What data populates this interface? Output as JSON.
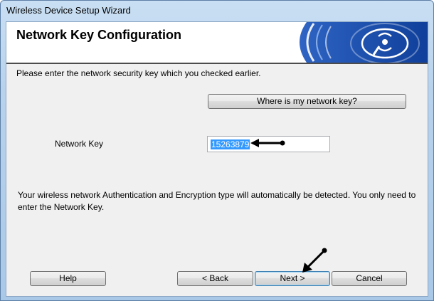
{
  "window": {
    "title": "Wireless Device Setup Wizard"
  },
  "header": {
    "title": "Network Key Configuration"
  },
  "instruction": "Please enter the network security key which you checked earlier.",
  "where_button": {
    "label": "Where is my network key?"
  },
  "network_key": {
    "label": "Network Key",
    "value": "15263879"
  },
  "info_text": "Your wireless network Authentication and Encryption type will automatically be detected. You only need to enter the Network Key.",
  "footer": {
    "help_label": "Help",
    "back_label": "< Back",
    "next_label": "Next >",
    "cancel_label": "Cancel"
  },
  "colors": {
    "accent_blue": "#1b4fa8",
    "selection": "#3399ff"
  },
  "icons": [
    "wireless-logo-icon"
  ]
}
